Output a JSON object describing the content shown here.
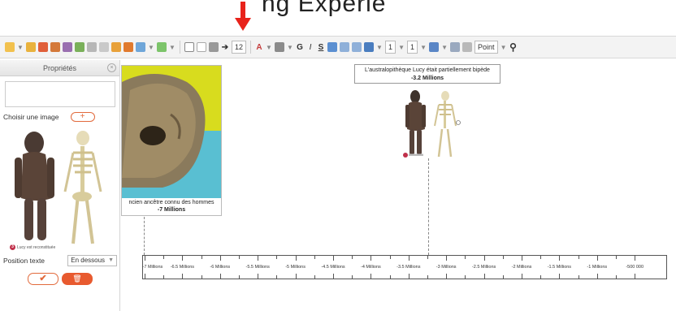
{
  "title_fragment": "ng Experie",
  "toolbar": {
    "font_size": "12",
    "spacing_1": "1",
    "spacing_2": "1",
    "unit_select": "Point",
    "letters": [
      "A",
      "G",
      "I",
      "S"
    ]
  },
  "panel": {
    "header": "Propriétés",
    "choose_image_label": "Choisir une image",
    "thumb_caption_num": "3",
    "thumb_caption": "Lucy est reconstituée",
    "position_label": "Position texte",
    "position_value": "En dessous"
  },
  "events": [
    {
      "text": "ncien ancêtre connu des hommes",
      "date": "-7 Millions"
    },
    {
      "text": "L'australopithèque Lucy était partiellement bipède",
      "date": "-3.2 Millions"
    }
  ],
  "lucy_caption_num": "3",
  "timeline": {
    "labels": [
      "-7 Millions",
      "-6.5 Millions",
      "-6 Millions",
      "-5.5 Millions",
      "-5 Millions",
      "-4.5 Millions",
      "-4 Millions",
      "-3.5 Millions",
      "-3 Millions",
      "-2.5 Millions",
      "-2 Millions",
      "-1.5 Millions",
      "-1 Millions",
      "-500 000"
    ]
  },
  "colors": {
    "arrow": "#e8231b",
    "accent": "#e26a3c",
    "delete": "#e85a2f",
    "card_yellow": "#d8dc1e",
    "card_teal": "#59bfd2"
  }
}
